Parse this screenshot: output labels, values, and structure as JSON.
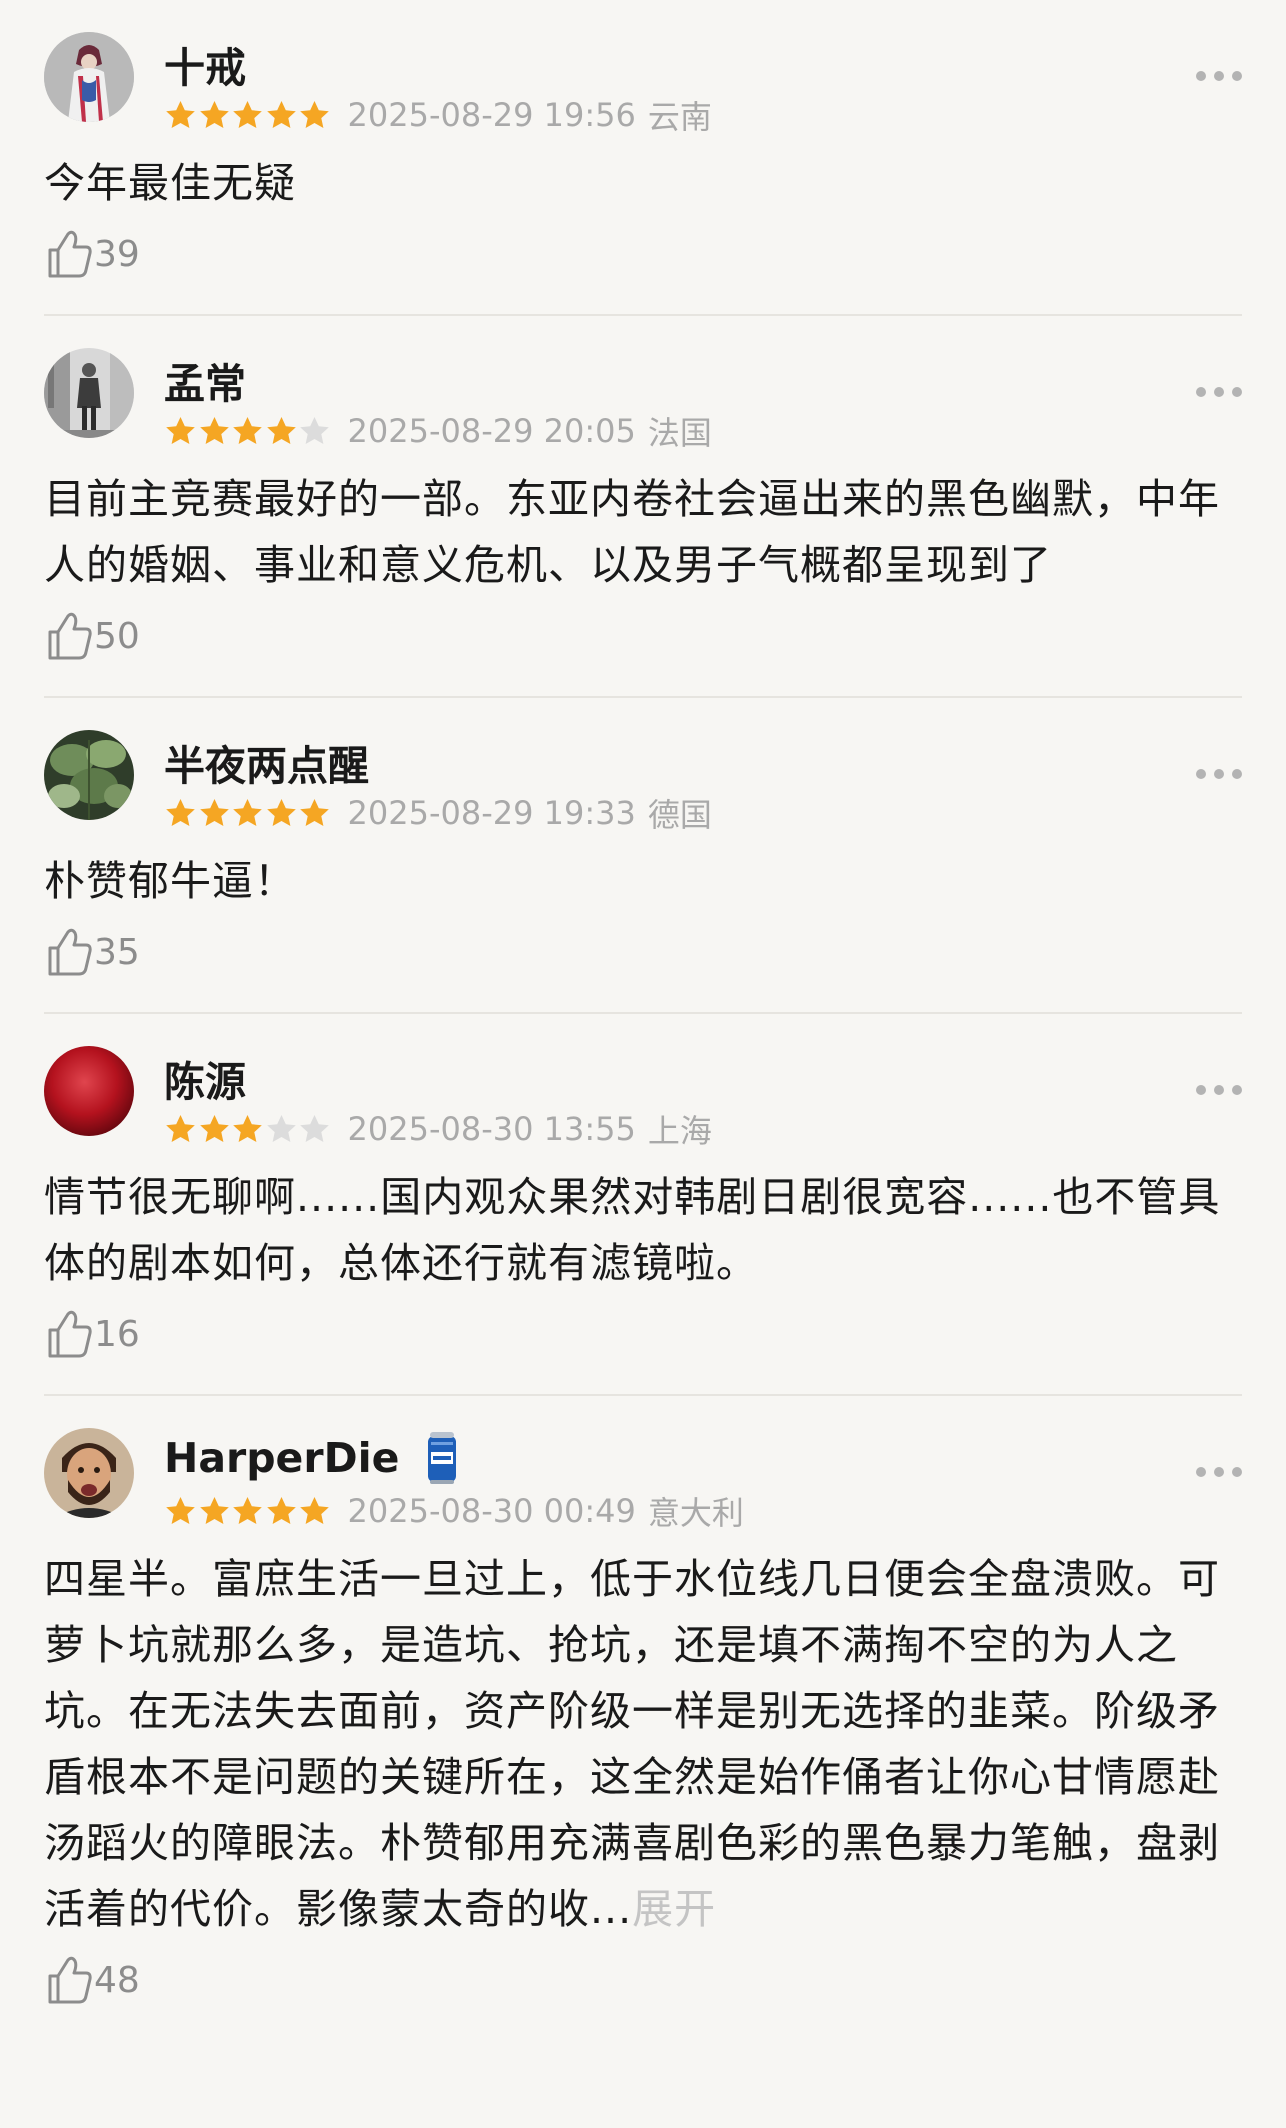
{
  "reviews": [
    {
      "username": "十戒",
      "rating": 5,
      "date": "2025-08-29 19:56",
      "location": "云南",
      "content": "今年最佳无疑",
      "likes": "39",
      "avatar": "costume-figure-avatar"
    },
    {
      "username": "孟常",
      "rating": 4,
      "date": "2025-08-29 20:05",
      "location": "法国",
      "content": "目前主竞赛最好的一部。东亚内卷社会逼出来的黑色幽默，中年人的婚姻、事业和意义危机、以及男子气概都呈现到了",
      "likes": "50",
      "avatar": "street-person-avatar"
    },
    {
      "username": "半夜两点醒",
      "rating": 5,
      "date": "2025-08-29 19:33",
      "location": "德国",
      "content": "朴赞郁牛逼！",
      "likes": "35",
      "avatar": "plant-leaves-avatar"
    },
    {
      "username": "陈源",
      "rating": 3,
      "date": "2025-08-30 13:55",
      "location": "上海",
      "content": "情节很无聊啊......国内观众果然对韩剧日剧很宽容......也不管具体的剧本如何，总体还行就有滤镜啦。",
      "likes": "16",
      "avatar": "red-blur-avatar"
    },
    {
      "username": "HarperDie",
      "rating": 5,
      "date": "2025-08-30 00:49",
      "location": "意大利",
      "content": "四星半。富庶生活一旦过上，低于水位线几日便会全盘溃败。可萝卜坑就那么多，是造坑、抢坑，还是填不满掏不空的为人之坑。在无法失去面前，资产阶级一样是别无选择的韭菜。阶级矛盾根本不是问题的关键所在，这全然是始作俑者让你心甘情愿赴汤蹈火的障眼法。朴赞郁用充满喜剧色彩的黑色暴力笔触，盘剥活着的代价。影像蒙太奇的收...",
      "expand_label": "展开",
      "likes": "48",
      "avatar": "bearded-man-avatar",
      "badge": "beer-can-badge"
    }
  ],
  "colors": {
    "star_on": "#f5a623",
    "star_off": "#dcdcdc",
    "meta": "#a9a9a9",
    "likes": "#8c8c8c",
    "expand": "#c4c4c4"
  }
}
